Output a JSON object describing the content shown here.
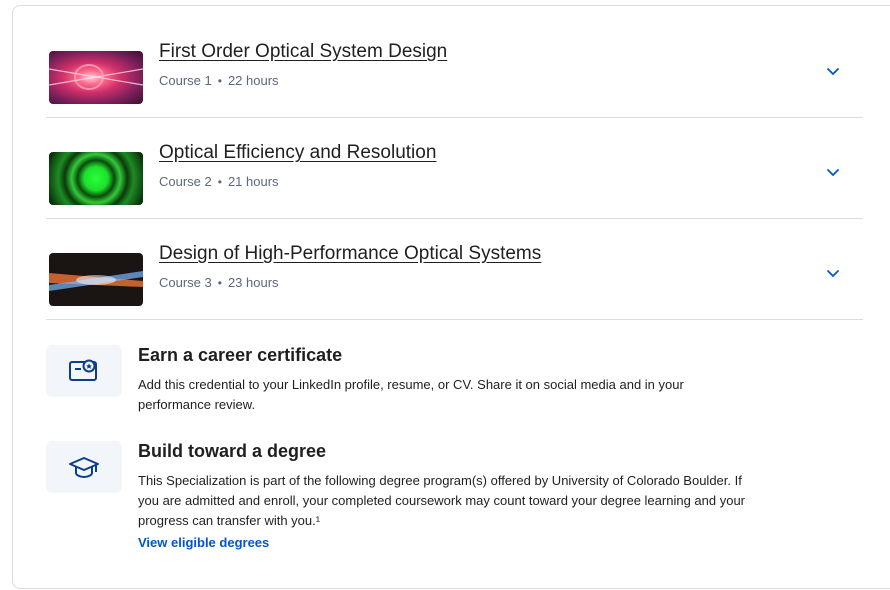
{
  "courses": [
    {
      "title": "First Order Optical System Design",
      "course_label": "Course 1",
      "bullet": "•",
      "duration": "22 hours"
    },
    {
      "title": "Optical Efficiency and Resolution",
      "course_label": "Course 2",
      "bullet": "•",
      "duration": "21 hours"
    },
    {
      "title": "Design of High-Performance Optical Systems",
      "course_label": "Course 3",
      "bullet": "•",
      "duration": "23 hours"
    }
  ],
  "career": {
    "title": "Earn a career certificate",
    "body": "Add this credential to your LinkedIn profile, resume, or CV. Share it on social media and in your performance review."
  },
  "degree": {
    "title": "Build toward a degree",
    "body": "This Specialization is part of the following degree program(s) offered by University of Colorado Boulder. If you are admitted and enroll, your completed coursework may count toward your degree learning and your progress can transfer with you.¹",
    "link": "View eligible degrees"
  },
  "colors": {
    "accent": "#0056d2",
    "icon_bg": "#f2f5fa",
    "border": "#dadce0",
    "muted": "#5b6780"
  },
  "icons": {
    "chevron": "chevron-down-icon",
    "certificate": "certificate-icon",
    "degree": "graduation-cap-icon"
  }
}
